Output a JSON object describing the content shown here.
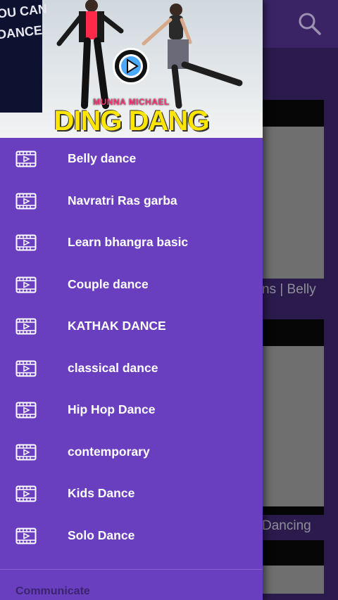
{
  "header": {
    "subtitle": "MUNNA MICHAEL",
    "title": "DING DANG",
    "wall_text_1": "OU CAN",
    "wall_text_2": "DANCE"
  },
  "menu": {
    "items": [
      {
        "label": "Belly dance",
        "icon": "video-icon"
      },
      {
        "label": "Navratri Ras garba",
        "icon": "video-icon"
      },
      {
        "label": "Learn bhangra basic",
        "icon": "video-icon"
      },
      {
        "label": "Couple dance",
        "icon": "video-icon"
      },
      {
        "label": "KATHAK DANCE",
        "icon": "video-icon"
      },
      {
        "label": "classical dance",
        "icon": "video-icon"
      },
      {
        "label": "Hip Hop Dance",
        "icon": "video-icon"
      },
      {
        "label": "contemporary",
        "icon": "video-icon"
      },
      {
        "label": "Kids Dance",
        "icon": "video-icon"
      },
      {
        "label": "Solo Dance",
        "icon": "video-icon"
      }
    ],
    "section_label": "Communicate"
  },
  "background": {
    "card1_text": "ns | Belly",
    "card2_text": "Dancing"
  },
  "colors": {
    "drawer": "#6a3fbf",
    "app_bar": "#3a2466",
    "title_yellow": "#ffe600"
  }
}
